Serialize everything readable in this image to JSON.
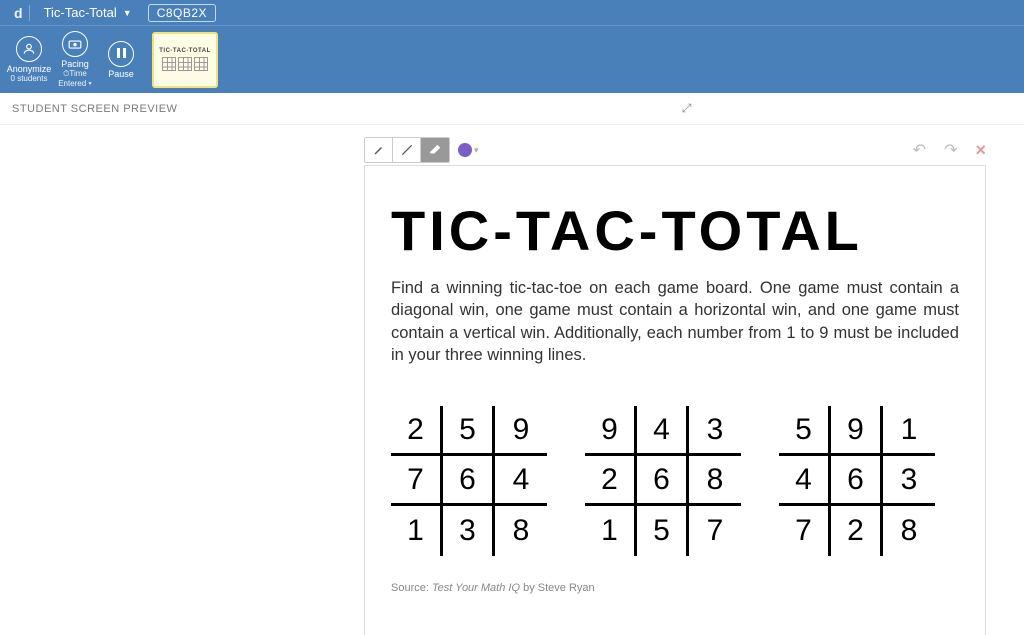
{
  "header": {
    "logo": "d",
    "title": "Tic-Tac-Total",
    "code": "C8QB2X",
    "tools": {
      "anonymize": {
        "label": "Anonymize",
        "sub": "0 students"
      },
      "pacing": {
        "label": "Pacing",
        "sub": "⏱Time Entered ▾"
      },
      "pause": {
        "label": "Pause",
        "sub": ""
      }
    },
    "thumb_label": "TIC-TAC-TOTAL"
  },
  "preview_label": "STUDENT SCREEN PREVIEW",
  "canvas_toolbar": {
    "color": "#7b5fc9"
  },
  "worksheet": {
    "title": "TIC-TAC-TOTAL",
    "instructions": "Find a winning tic-tac-toe on each game board. One game must contain a diagonal win, one game must contain a horizontal win, and one game must contain a vertical win. Additionally, each number from 1 to 9 must be included in your three winning lines.",
    "boards": [
      [
        [
          2,
          5,
          9
        ],
        [
          7,
          6,
          4
        ],
        [
          1,
          3,
          8
        ]
      ],
      [
        [
          9,
          4,
          3
        ],
        [
          2,
          6,
          8
        ],
        [
          1,
          5,
          7
        ]
      ],
      [
        [
          5,
          9,
          1
        ],
        [
          4,
          6,
          3
        ],
        [
          7,
          2,
          8
        ]
      ]
    ],
    "source_prefix": "Source: ",
    "source_title": "Test Your Math IQ",
    "source_suffix": " by Steve Ryan"
  }
}
